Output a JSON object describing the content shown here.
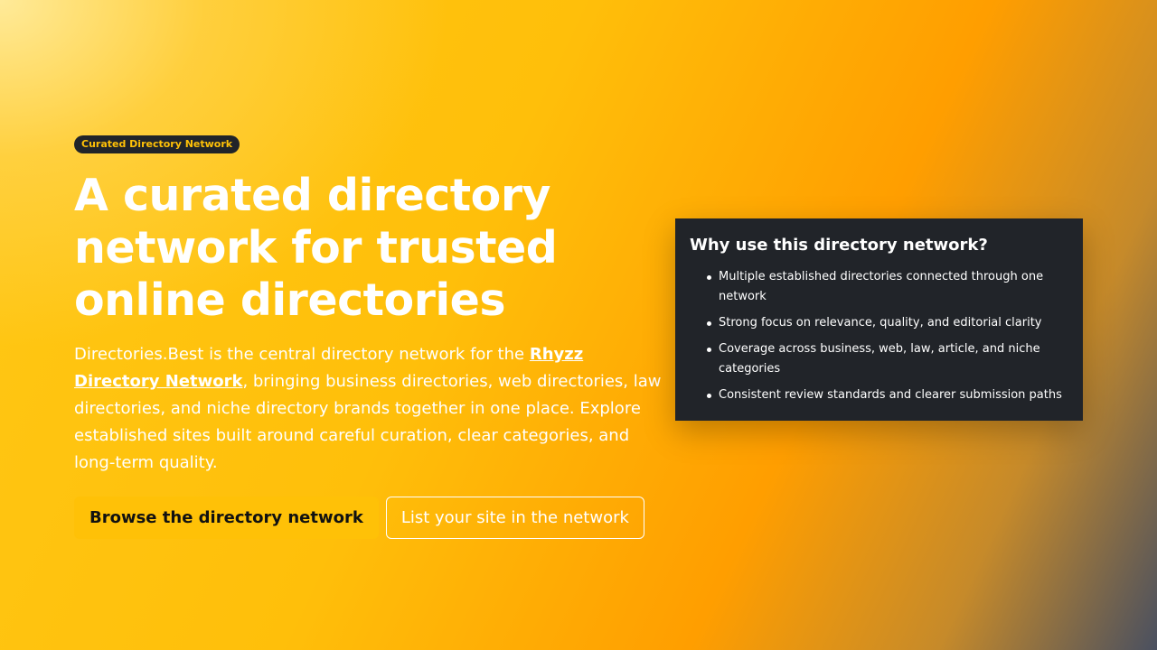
{
  "hero": {
    "badge": "Curated Directory Network",
    "title": "A curated directory network for trusted online directories",
    "lead_before": "Directories.Best is the central directory network for the ",
    "lead_link": "Rhyzz Directory Network",
    "lead_after": ", bringing business directories, web directories, law directories, and niche directory brands together in one place. Explore established sites built around careful curation, clear categories, and long-term quality.",
    "primary_button": "Browse the directory network",
    "secondary_button": "List your site in the network"
  },
  "card": {
    "title": "Why use this directory network?",
    "items": [
      "Multiple established directories connected through one network",
      "Strong focus on relevance, quality, and editorial clarity",
      "Coverage across business, web, law, article, and niche categories",
      "Consistent review standards and clearer submission paths"
    ]
  },
  "colors": {
    "accent": "#ffc107",
    "card_background": "#212429"
  }
}
